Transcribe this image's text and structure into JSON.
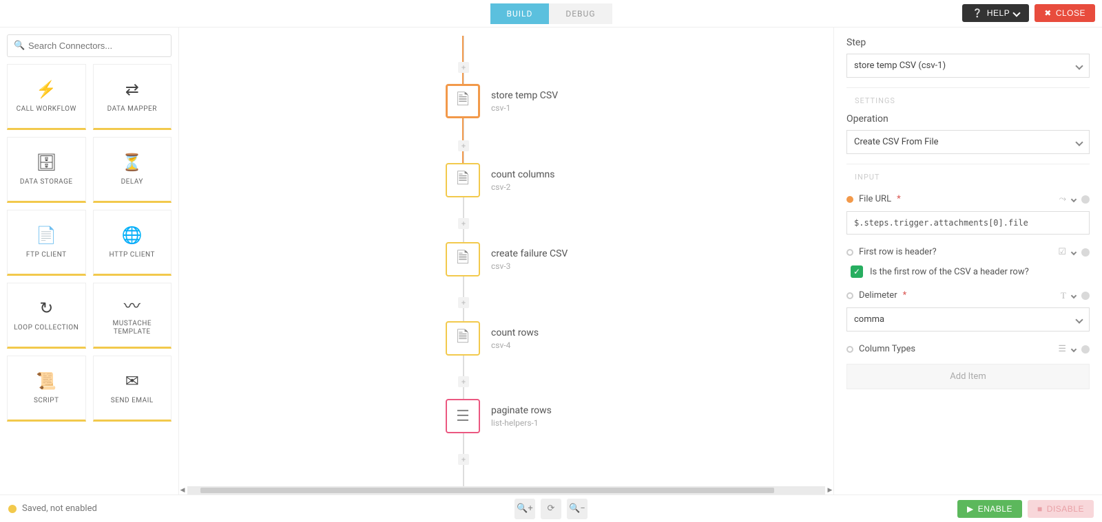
{
  "top": {
    "tabs": {
      "build": "BUILD",
      "debug": "DEBUG"
    },
    "help": "HELP",
    "close": "CLOSE"
  },
  "sidebar": {
    "search_placeholder": "Search Connectors...",
    "connectors": [
      {
        "label": "CALL WORKFLOW",
        "icon": "⚡"
      },
      {
        "label": "DATA MAPPER",
        "icon": "⇄"
      },
      {
        "label": "DATA STORAGE",
        "icon": "🗄"
      },
      {
        "label": "DELAY",
        "icon": "⏳"
      },
      {
        "label": "FTP CLIENT",
        "icon": "📄"
      },
      {
        "label": "HTTP CLIENT",
        "icon": "🌐"
      },
      {
        "label": "LOOP COLLECTION",
        "icon": "↻"
      },
      {
        "label": "MUSTACHE TEMPLATE",
        "icon": "〰"
      },
      {
        "label": "SCRIPT",
        "icon": "📜"
      },
      {
        "label": "SEND EMAIL",
        "icon": "✉"
      }
    ]
  },
  "flow": {
    "nodes": [
      {
        "title": "store temp CSV",
        "sub": "csv-1",
        "kind": "csv",
        "selected": true,
        "icon": "🗎"
      },
      {
        "title": "count columns",
        "sub": "csv-2",
        "kind": "csv",
        "selected": false,
        "icon": "🗎"
      },
      {
        "title": "create failure CSV",
        "sub": "csv-3",
        "kind": "csv",
        "selected": false,
        "icon": "🗎"
      },
      {
        "title": "count rows",
        "sub": "csv-4",
        "kind": "csv",
        "selected": false,
        "icon": "🗎"
      },
      {
        "title": "paginate rows",
        "sub": "list-helpers-1",
        "kind": "list",
        "selected": false,
        "icon": "☰"
      }
    ]
  },
  "panel": {
    "step_label": "Step",
    "step_value": "store temp CSV (csv-1)",
    "section_settings": "SETTINGS",
    "operation_label": "Operation",
    "operation_value": "Create CSV From File",
    "section_input": "INPUT",
    "fields": {
      "file_url_label": "File URL",
      "file_url_value": "$.steps.trigger.attachments[0].file",
      "first_row_label": "First row is header?",
      "first_row_help": "Is the first row of the CSV a header row?",
      "delimiter_label": "Delimeter",
      "delimiter_value": "comma",
      "column_types_label": "Column Types",
      "add_item": "Add Item"
    }
  },
  "footer": {
    "status": "Saved, not enabled",
    "enable": "ENABLE",
    "disable": "DISABLE"
  }
}
